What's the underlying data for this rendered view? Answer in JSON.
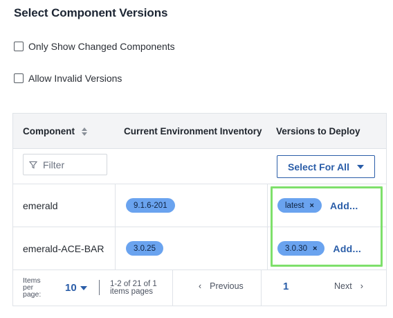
{
  "title": "Select Component Versions",
  "options": [
    {
      "label": "Only Show Changed Components",
      "checked": false
    },
    {
      "label": "Allow Invalid Versions",
      "checked": false
    }
  ],
  "table": {
    "headers": {
      "component": "Component",
      "inventory": "Current Environment Inventory",
      "versions": "Versions to Deploy"
    },
    "filter_placeholder": "Filter",
    "select_for_all": "Select For All",
    "rows": [
      {
        "component": "emerald",
        "inventory": "9.1.6-201",
        "version": "latest",
        "add_label": "Add..."
      },
      {
        "component": "emerald-ACE-BAR",
        "inventory": "3.0.25",
        "version": "3.0.30",
        "add_label": "Add..."
      }
    ],
    "pagination": {
      "items_per_page_label": "Items per page:",
      "items_per_page": "10",
      "range": "1-2 of 21 of 1 items pages",
      "previous": "Previous",
      "page": "1",
      "next": "Next"
    }
  },
  "colors": {
    "accent": "#2a5da8",
    "pill": "#6aa3ef",
    "highlight": "#7ee06b"
  }
}
